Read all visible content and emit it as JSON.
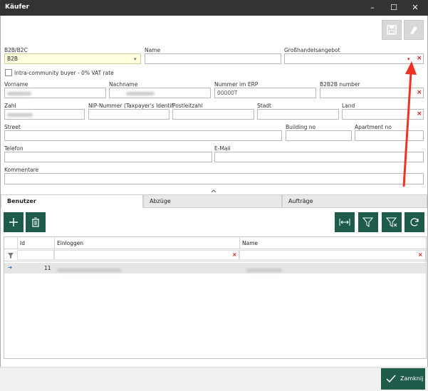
{
  "window": {
    "title": "Käufer",
    "minimize": "–",
    "maximize": "☐",
    "close": "✕"
  },
  "toolbar": {
    "save_icon": "save-icon",
    "eraser_icon": "eraser-icon"
  },
  "form": {
    "b2b_label": "B2B/B2C",
    "b2b_value": "B2B",
    "name_label": "Name",
    "wholesale_label": "Großhandelsangebot",
    "intra_label": "Intra-community buyer - 0% VAT rate",
    "vorname_label": "Vorname",
    "nachname_label": "Nachname",
    "erp_label": "Nummer im ERP",
    "erp_value": "00000T",
    "b2b2b_label": "B2B2B number",
    "zahl_label": "Zahl",
    "nip_label": "NIP-Nummer (Taxpayer's Identif",
    "plz_label": "Postleitzahl",
    "stadt_label": "Stadt",
    "land_label": "Land",
    "street_label": "Street",
    "building_label": "Building no",
    "apartment_label": "Apartment no",
    "telefon_label": "Telefon",
    "email_label": "E-Mail",
    "kommentare_label": "Kommentare",
    "clear": "×",
    "dropdown": "▾"
  },
  "tabs": [
    {
      "label": "Benutzer"
    },
    {
      "label": "Abzüge"
    },
    {
      "label": "Aufträge"
    }
  ],
  "grid": {
    "columns": {
      "id": "Id",
      "login": "Einloggen",
      "name": "Name"
    },
    "rows": [
      {
        "arrow": "➔",
        "id": "11"
      }
    ]
  },
  "footer": {
    "ok_label": "Zamknij"
  }
}
